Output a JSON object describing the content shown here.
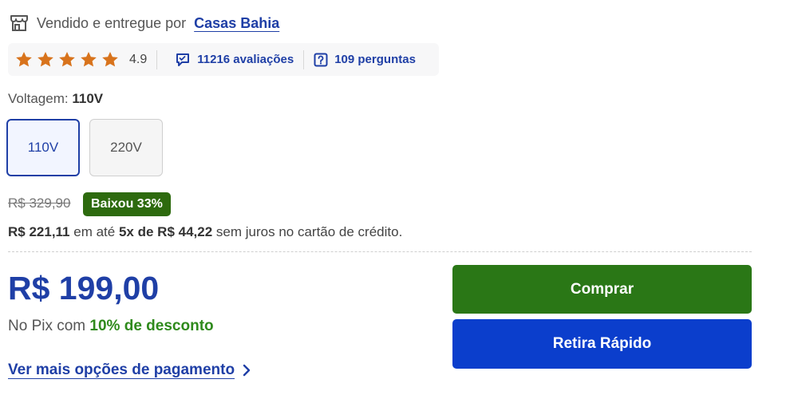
{
  "seller": {
    "prefix": "Vendido e entregue por",
    "name": "Casas Bahia"
  },
  "rating": {
    "score": "4.9",
    "stars": 5,
    "reviews_label": "11216 avaliações",
    "questions_label": "109 perguntas"
  },
  "voltage": {
    "label": "Voltagem:",
    "selected": "110V",
    "options": [
      "110V",
      "220V"
    ]
  },
  "pricing": {
    "old_price": "R$ 329,90",
    "discount_badge": "Baixou 33%",
    "installment_total": "R$ 221,11",
    "installment_mid": "em até",
    "installment_plan": "5x de R$ 44,22",
    "installment_suffix": "sem juros no cartão de crédito.",
    "price": "R$ 199,00",
    "pix_prefix": "No Pix com",
    "pix_discount": "10% de desconto",
    "more_payment": "Ver mais opções de pagamento"
  },
  "actions": {
    "buy": "Comprar",
    "pickup": "Retira Rápido"
  },
  "colors": {
    "primary_blue": "#1f3fa6",
    "star_orange": "#d8731c",
    "buy_green": "#2a7716",
    "pickup_blue": "#0b3ecc",
    "badge_green": "#2d6a0e"
  },
  "icons": {
    "store": "store-icon",
    "star": "star-icon",
    "reviews": "chat-bubble-icon",
    "questions": "question-icon",
    "chevron": "chevron-right-icon"
  }
}
